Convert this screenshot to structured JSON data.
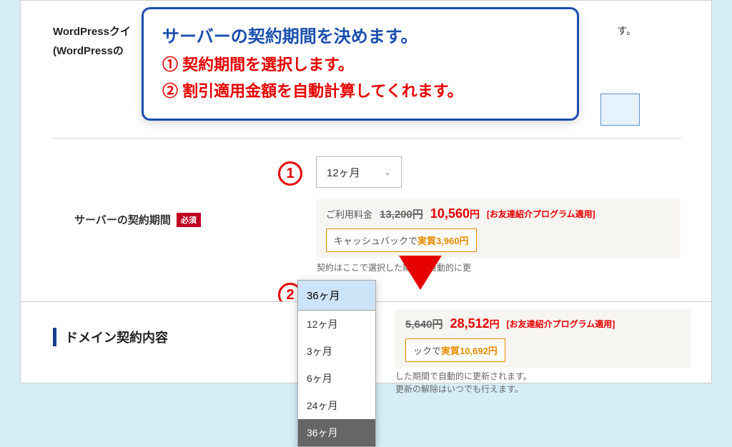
{
  "header": {
    "wp_title_partial": "WordPressクイ",
    "wp_subtitle_partial": "(WordPressの",
    "truncated_text": "す。"
  },
  "callout": {
    "line1": "サーバーの契約期間を決めます。",
    "line2": "① 契約期間を選択します。",
    "line3": "② 割引適用金額を自動計算してくれます。"
  },
  "markers": {
    "m1": "1",
    "m2": "2"
  },
  "contract_period": {
    "label": "サーバーの契約期間",
    "required_badge": "必須",
    "selected": "12ヶ月",
    "dropdown_selected": "36ヶ月",
    "options": [
      "12ヶ月",
      "3ヶ月",
      "6ヶ月",
      "24ヶ月",
      "36ヶ月"
    ]
  },
  "pricing1": {
    "fee_label": "ご利用料金",
    "original": "13,200",
    "original_yen": "円",
    "discounted": "10,560",
    "discounted_yen": "円",
    "promo": "[お友達紹介プログラム適用]",
    "cashback_prefix": "キャッシュバックで",
    "cashback_label": "実質",
    "cashback_value": "3,960",
    "cashback_yen": "円"
  },
  "note1": "契約はここで選択した期間で自動的に更",
  "section2_heading": "ドメイン契約内容",
  "pricing2": {
    "original": "5,640",
    "original_yen": "円",
    "discounted": "28,512",
    "discounted_yen": "円",
    "promo": "[お友達紹介プログラム適用]",
    "cashback_suffix": "ックで",
    "cashback_label": "実質",
    "cashback_value": "10,692",
    "cashback_yen": "円"
  },
  "note2_line1": "した期間で自動的に更新されます。",
  "note2_line2": "更新の解除はいつでも行えます。"
}
